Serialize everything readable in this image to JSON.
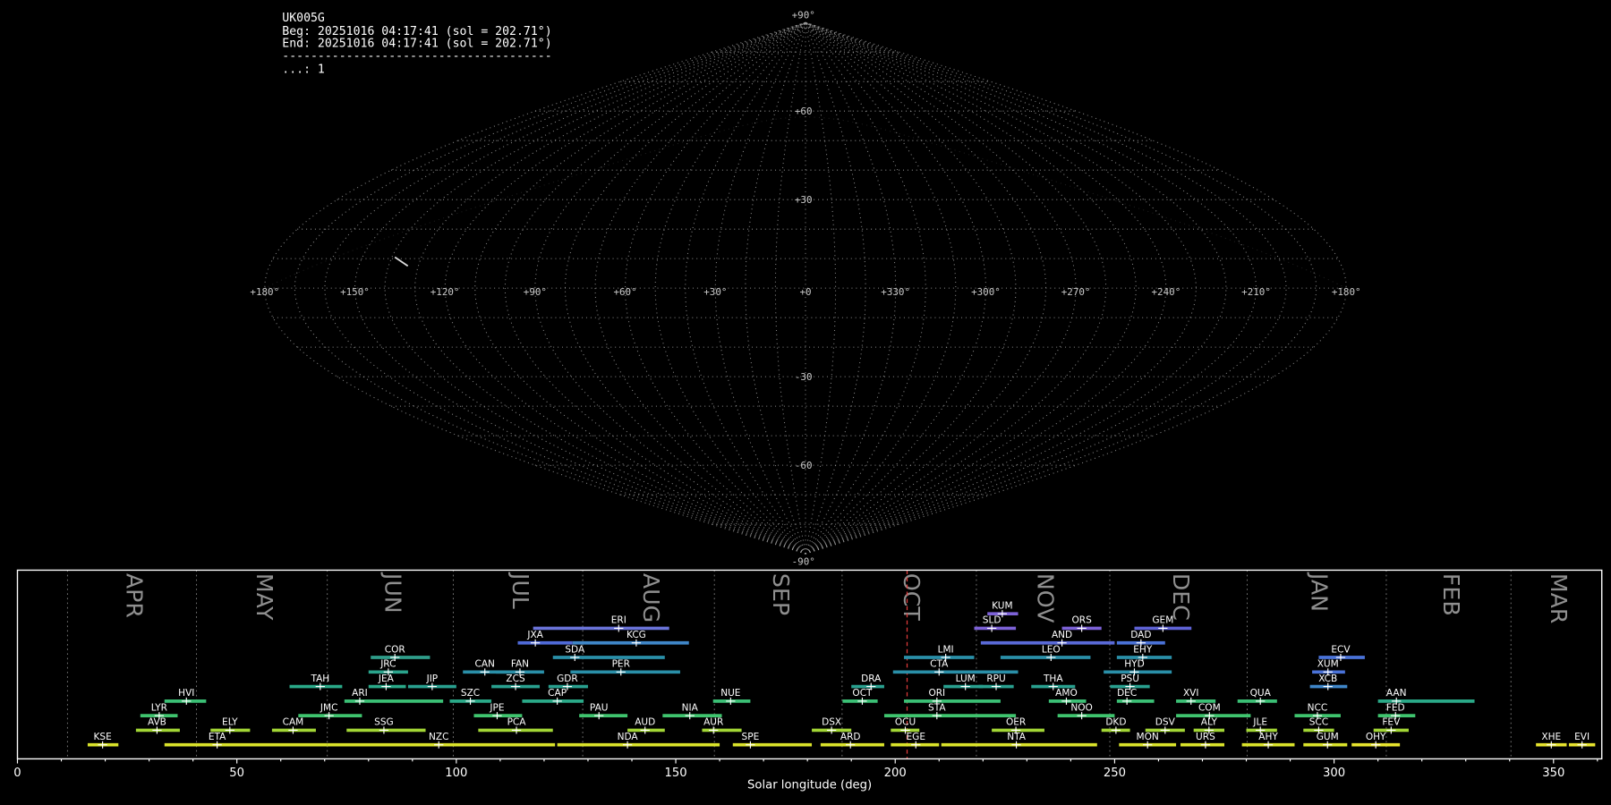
{
  "header": {
    "station": "UK005G",
    "beg": "Beg: 20251016 04:17:41 (sol = 202.71°)",
    "end": "End: 20251016 04:17:41 (sol = 202.71°)",
    "separator": "--------------------------------------",
    "count_line": "...: 1"
  },
  "skymap": {
    "lon_grid_step": 10,
    "lat_grid_step": 10,
    "ecliptic_peak_lat": 58,
    "lat_labels": [
      {
        "text": "+90°",
        "lat": 90
      },
      {
        "text": "+60",
        "lat": 60
      },
      {
        "text": "+30",
        "lat": 30
      },
      {
        "text": "-30",
        "lat": -30
      },
      {
        "text": "-60",
        "lat": -60
      },
      {
        "text": "-90°",
        "lat": -90
      }
    ],
    "lon_labels": [
      {
        "text": "+180°",
        "u": 180
      },
      {
        "text": "+150°",
        "u": 150
      },
      {
        "text": "+120°",
        "u": 120
      },
      {
        "text": "+90°",
        "u": 90
      },
      {
        "text": "+60°",
        "u": 60
      },
      {
        "text": "+30°",
        "u": 30
      },
      {
        "text": "+0",
        "u": 0
      },
      {
        "text": "+330°",
        "u": -30
      },
      {
        "text": "+300°",
        "u": -60
      },
      {
        "text": "+270°",
        "u": -90
      },
      {
        "text": "+240°",
        "u": -120
      },
      {
        "text": "+210°",
        "u": -150
      },
      {
        "text": "+180°",
        "u": -180
      }
    ],
    "meteor": {
      "u1": 139,
      "lat1": 10.5,
      "u2": 133.5,
      "lat2": 7.5,
      "color": "#dddddd"
    }
  },
  "chart_data": {
    "type": "timeline",
    "xlabel": "Solar longitude (deg)",
    "x_ticks": [
      0,
      50,
      100,
      150,
      200,
      250,
      300,
      350
    ],
    "x_minor_step": 10,
    "xlim": [
      0,
      361
    ],
    "now_sol": 202.71,
    "now_color": "#e03b3b",
    "months": [
      {
        "label": "APR",
        "start_sol": 11.4
      },
      {
        "label": "MAY",
        "start_sol": 40.8
      },
      {
        "label": "JUN",
        "start_sol": 70.6
      },
      {
        "label": "JUL",
        "start_sol": 99.3
      },
      {
        "label": "AUG",
        "start_sol": 128.8
      },
      {
        "label": "SEP",
        "start_sol": 158.8
      },
      {
        "label": "OCT",
        "start_sol": 187.9
      },
      {
        "label": "NOV",
        "start_sol": 218.5
      },
      {
        "label": "DEC",
        "start_sol": 248.9
      },
      {
        "label": "JAN",
        "start_sol": 280.2
      },
      {
        "label": "FEB",
        "start_sol": 311.9
      },
      {
        "label": "MAR",
        "start_sol": 340.3
      }
    ],
    "rows": 10,
    "showers": [
      {
        "code": "KUM",
        "row": 0,
        "start": 221,
        "end": 228,
        "peak": 224.4,
        "color": "#7d62d8"
      },
      {
        "code": "ERI",
        "row": 1,
        "start": 117.5,
        "end": 148.5,
        "peak": 137,
        "color": "#6b74da"
      },
      {
        "code": "SLD",
        "row": 1,
        "start": 218,
        "end": 227.5,
        "peak": 222,
        "color": "#7d62d8"
      },
      {
        "code": "ORS",
        "row": 1,
        "start": 238,
        "end": 247,
        "peak": 242.5,
        "color": "#7d62d8"
      },
      {
        "code": "GEM",
        "row": 1,
        "start": 254.5,
        "end": 267.5,
        "peak": 261,
        "color": "#5f63d6"
      },
      {
        "code": "JXA",
        "row": 2,
        "start": 114,
        "end": 126.5,
        "peak": 118,
        "color": "#4f6ad8"
      },
      {
        "code": "KCG",
        "row": 2,
        "start": 126.5,
        "end": 153,
        "peak": 141,
        "color": "#3f86c8"
      },
      {
        "code": "AND",
        "row": 2,
        "start": 219.5,
        "end": 250,
        "peak": 238,
        "color": "#5a6ad8"
      },
      {
        "code": "DAD",
        "row": 2,
        "start": 250.5,
        "end": 261.5,
        "peak": 256,
        "color": "#4a72d8"
      },
      {
        "code": "COR",
        "row": 3,
        "start": 80.5,
        "end": 94,
        "peak": 86,
        "color": "#2f9d8a"
      },
      {
        "code": "SDA",
        "row": 3,
        "start": 122,
        "end": 147.5,
        "peak": 127,
        "color": "#2a8fa8"
      },
      {
        "code": "LMI",
        "row": 3,
        "start": 202,
        "end": 218,
        "peak": 211.5,
        "color": "#2a8fa8"
      },
      {
        "code": "LEO",
        "row": 3,
        "start": 224,
        "end": 244.5,
        "peak": 235.5,
        "color": "#2a8fa8"
      },
      {
        "code": "EHY",
        "row": 3,
        "start": 250.5,
        "end": 263,
        "peak": 256.4,
        "color": "#2a8fa8"
      },
      {
        "code": "ECV",
        "row": 3,
        "start": 296.5,
        "end": 307,
        "peak": 301.5,
        "color": "#4a72d8"
      },
      {
        "code": "JRC",
        "row": 4,
        "start": 80,
        "end": 89,
        "peak": 84.5,
        "color": "#2aa48c"
      },
      {
        "code": "CAN",
        "row": 4,
        "start": 101.5,
        "end": 113,
        "peak": 106.5,
        "color": "#2a8fa8"
      },
      {
        "code": "FAN",
        "row": 4,
        "start": 109,
        "end": 120,
        "peak": 114.5,
        "color": "#2a8fa8"
      },
      {
        "code": "PER",
        "row": 4,
        "start": 126,
        "end": 151,
        "peak": 137.5,
        "color": "#2a8fa8"
      },
      {
        "code": "CTA",
        "row": 4,
        "start": 199.5,
        "end": 228,
        "peak": 210,
        "color": "#2a8fa8"
      },
      {
        "code": "HYD",
        "row": 4,
        "start": 247.5,
        "end": 263,
        "peak": 254.5,
        "color": "#2a8fa8"
      },
      {
        "code": "XUM",
        "row": 4,
        "start": 295,
        "end": 302.5,
        "peak": 298.6,
        "color": "#4a72d8"
      },
      {
        "code": "TAH",
        "row": 5,
        "start": 62,
        "end": 74,
        "peak": 69,
        "color": "#2aa988"
      },
      {
        "code": "JEA",
        "row": 5,
        "start": 80,
        "end": 88.5,
        "peak": 84,
        "color": "#2aa988"
      },
      {
        "code": "JIP",
        "row": 5,
        "start": 89,
        "end": 100,
        "peak": 94.5,
        "color": "#29a08f"
      },
      {
        "code": "ZCS",
        "row": 5,
        "start": 108,
        "end": 119,
        "peak": 113.5,
        "color": "#29a08f"
      },
      {
        "code": "GDR",
        "row": 5,
        "start": 121,
        "end": 130,
        "peak": 125.3,
        "color": "#29a08f"
      },
      {
        "code": "DRA",
        "row": 5,
        "start": 190,
        "end": 197.5,
        "peak": 194.5,
        "color": "#29a08f"
      },
      {
        "code": "LUM",
        "row": 5,
        "start": 211,
        "end": 220,
        "peak": 216,
        "color": "#29a08f"
      },
      {
        "code": "RPU",
        "row": 5,
        "start": 219,
        "end": 227,
        "peak": 223,
        "color": "#29a08f"
      },
      {
        "code": "THA",
        "row": 5,
        "start": 231,
        "end": 241,
        "peak": 236,
        "color": "#29a08f"
      },
      {
        "code": "PSU",
        "row": 5,
        "start": 249,
        "end": 258,
        "peak": 253.5,
        "color": "#29a08f"
      },
      {
        "code": "XCB",
        "row": 5,
        "start": 294.5,
        "end": 303,
        "peak": 298.6,
        "color": "#3f86c8"
      },
      {
        "code": "HVI",
        "row": 6,
        "start": 33.5,
        "end": 43,
        "peak": 38.5,
        "color": "#3bbf75"
      },
      {
        "code": "ARI",
        "row": 6,
        "start": 74.5,
        "end": 97,
        "peak": 78,
        "color": "#3bbf75"
      },
      {
        "code": "SZC",
        "row": 6,
        "start": 98.5,
        "end": 108,
        "peak": 103.2,
        "color": "#2aa988"
      },
      {
        "code": "CAP",
        "row": 6,
        "start": 115,
        "end": 129,
        "peak": 123,
        "color": "#2aa988"
      },
      {
        "code": "NUE",
        "row": 6,
        "start": 158.5,
        "end": 167,
        "peak": 162.5,
        "color": "#3bbf75"
      },
      {
        "code": "OCT",
        "row": 6,
        "start": 188,
        "end": 196,
        "peak": 192.5,
        "color": "#3bbf75"
      },
      {
        "code": "ORI",
        "row": 6,
        "start": 202,
        "end": 224,
        "peak": 209.5,
        "color": "#3bbf75"
      },
      {
        "code": "AMO",
        "row": 6,
        "start": 235,
        "end": 243.5,
        "peak": 239,
        "color": "#3bbf75"
      },
      {
        "code": "DEC",
        "row": 6,
        "start": 250.5,
        "end": 259,
        "peak": 252.8,
        "color": "#3bbf75"
      },
      {
        "code": "XVI",
        "row": 6,
        "start": 264,
        "end": 273,
        "peak": 267.4,
        "color": "#3bbf75"
      },
      {
        "code": "QUA",
        "row": 6,
        "start": 278,
        "end": 287,
        "peak": 283.2,
        "color": "#3bbf75"
      },
      {
        "code": "AAN",
        "row": 6,
        "start": 310,
        "end": 332,
        "peak": 314.2,
        "color": "#2aa988"
      },
      {
        "code": "LYR",
        "row": 7,
        "start": 28,
        "end": 36.5,
        "peak": 32.3,
        "color": "#3fc46e"
      },
      {
        "code": "JMC",
        "row": 7,
        "start": 64,
        "end": 78.5,
        "peak": 71,
        "color": "#3fc46e"
      },
      {
        "code": "JPE",
        "row": 7,
        "start": 104,
        "end": 115,
        "peak": 109.3,
        "color": "#3fc46e"
      },
      {
        "code": "PAU",
        "row": 7,
        "start": 128,
        "end": 139,
        "peak": 132.5,
        "color": "#3fc46e"
      },
      {
        "code": "NIA",
        "row": 7,
        "start": 147,
        "end": 160.5,
        "peak": 153.2,
        "color": "#3fc46e"
      },
      {
        "code": "STA",
        "row": 7,
        "start": 197.5,
        "end": 227.5,
        "peak": 209.5,
        "color": "#3fc46e"
      },
      {
        "code": "NOO",
        "row": 7,
        "start": 237,
        "end": 250,
        "peak": 242.5,
        "color": "#3fc46e"
      },
      {
        "code": "COM",
        "row": 7,
        "start": 264,
        "end": 281,
        "peak": 271.6,
        "color": "#3fc46e"
      },
      {
        "code": "NCC",
        "row": 7,
        "start": 291,
        "end": 301.5,
        "peak": 296.2,
        "color": "#3fc46e"
      },
      {
        "code": "FED",
        "row": 7,
        "start": 310,
        "end": 318.5,
        "peak": 314,
        "color": "#3fc46e"
      },
      {
        "code": "AVB",
        "row": 8,
        "start": 27,
        "end": 37,
        "peak": 31.8,
        "color": "#a2d535"
      },
      {
        "code": "ELY",
        "row": 8,
        "start": 44,
        "end": 53,
        "peak": 48.4,
        "color": "#a2d535"
      },
      {
        "code": "CAM",
        "row": 8,
        "start": 58,
        "end": 68,
        "peak": 62.8,
        "color": "#a2d535"
      },
      {
        "code": "SSG",
        "row": 8,
        "start": 75,
        "end": 93,
        "peak": 83.5,
        "color": "#a2d535"
      },
      {
        "code": "PCA",
        "row": 8,
        "start": 105,
        "end": 122,
        "peak": 113.7,
        "color": "#a2d535"
      },
      {
        "code": "AUD",
        "row": 8,
        "start": 139,
        "end": 147.5,
        "peak": 143,
        "color": "#a2d535"
      },
      {
        "code": "AUR",
        "row": 8,
        "start": 156,
        "end": 165,
        "peak": 158.6,
        "color": "#a2d535"
      },
      {
        "code": "DSX",
        "row": 8,
        "start": 181,
        "end": 190,
        "peak": 185.5,
        "color": "#a2d535"
      },
      {
        "code": "OCU",
        "row": 8,
        "start": 199,
        "end": 205.5,
        "peak": 202.3,
        "color": "#a2d535"
      },
      {
        "code": "OER",
        "row": 8,
        "start": 222,
        "end": 234,
        "peak": 227.5,
        "color": "#a2d535"
      },
      {
        "code": "DKD",
        "row": 8,
        "start": 247,
        "end": 253.5,
        "peak": 250.3,
        "color": "#a2d535"
      },
      {
        "code": "DSV",
        "row": 8,
        "start": 257,
        "end": 266,
        "peak": 261.5,
        "color": "#a2d535"
      },
      {
        "code": "ALY",
        "row": 8,
        "start": 268,
        "end": 275,
        "peak": 271.5,
        "color": "#a2d535"
      },
      {
        "code": "JLE",
        "row": 8,
        "start": 280,
        "end": 287,
        "peak": 283.2,
        "color": "#a2d535"
      },
      {
        "code": "SCC",
        "row": 8,
        "start": 293,
        "end": 300,
        "peak": 296.5,
        "color": "#a2d535"
      },
      {
        "code": "FEV",
        "row": 8,
        "start": 309,
        "end": 317,
        "peak": 313,
        "color": "#a2d535"
      },
      {
        "code": "KSE",
        "row": 9,
        "start": 16,
        "end": 23,
        "peak": 19.4,
        "color": "#d9e22b"
      },
      {
        "code": "ETA",
        "row": 9,
        "start": 33.5,
        "end": 70.5,
        "peak": 45.5,
        "color": "#d9e22b"
      },
      {
        "code": "NZC",
        "row": 9,
        "start": 70.5,
        "end": 122.5,
        "peak": 96,
        "color": "#d9e22b"
      },
      {
        "code": "NDA",
        "row": 9,
        "start": 123,
        "end": 160,
        "peak": 139,
        "color": "#d9e22b"
      },
      {
        "code": "SPE",
        "row": 9,
        "start": 163,
        "end": 181,
        "peak": 167,
        "color": "#d9e22b"
      },
      {
        "code": "ARD",
        "row": 9,
        "start": 183,
        "end": 197.5,
        "peak": 189.8,
        "color": "#d9e22b"
      },
      {
        "code": "EGE",
        "row": 9,
        "start": 199,
        "end": 210,
        "peak": 204.7,
        "color": "#d9e22b"
      },
      {
        "code": "NTA",
        "row": 9,
        "start": 210.5,
        "end": 246,
        "peak": 227.6,
        "color": "#d9e22b"
      },
      {
        "code": "MON",
        "row": 9,
        "start": 251,
        "end": 264,
        "peak": 257.5,
        "color": "#d9e22b"
      },
      {
        "code": "URS",
        "row": 9,
        "start": 265,
        "end": 275,
        "peak": 270.7,
        "color": "#d9e22b"
      },
      {
        "code": "AHY",
        "row": 9,
        "start": 279,
        "end": 291,
        "peak": 285,
        "color": "#d9e22b"
      },
      {
        "code": "GUM",
        "row": 9,
        "start": 293,
        "end": 303,
        "peak": 298.5,
        "color": "#d9e22b"
      },
      {
        "code": "OHY",
        "row": 9,
        "start": 304,
        "end": 315,
        "peak": 309.5,
        "color": "#e6e32e"
      },
      {
        "code": "XHE",
        "row": 9,
        "start": 346,
        "end": 353,
        "peak": 349.5,
        "color": "#e6e32e"
      },
      {
        "code": "EVI",
        "row": 9,
        "start": 353.5,
        "end": 359.5,
        "peak": 356.5,
        "color": "#e6e32e"
      }
    ]
  }
}
